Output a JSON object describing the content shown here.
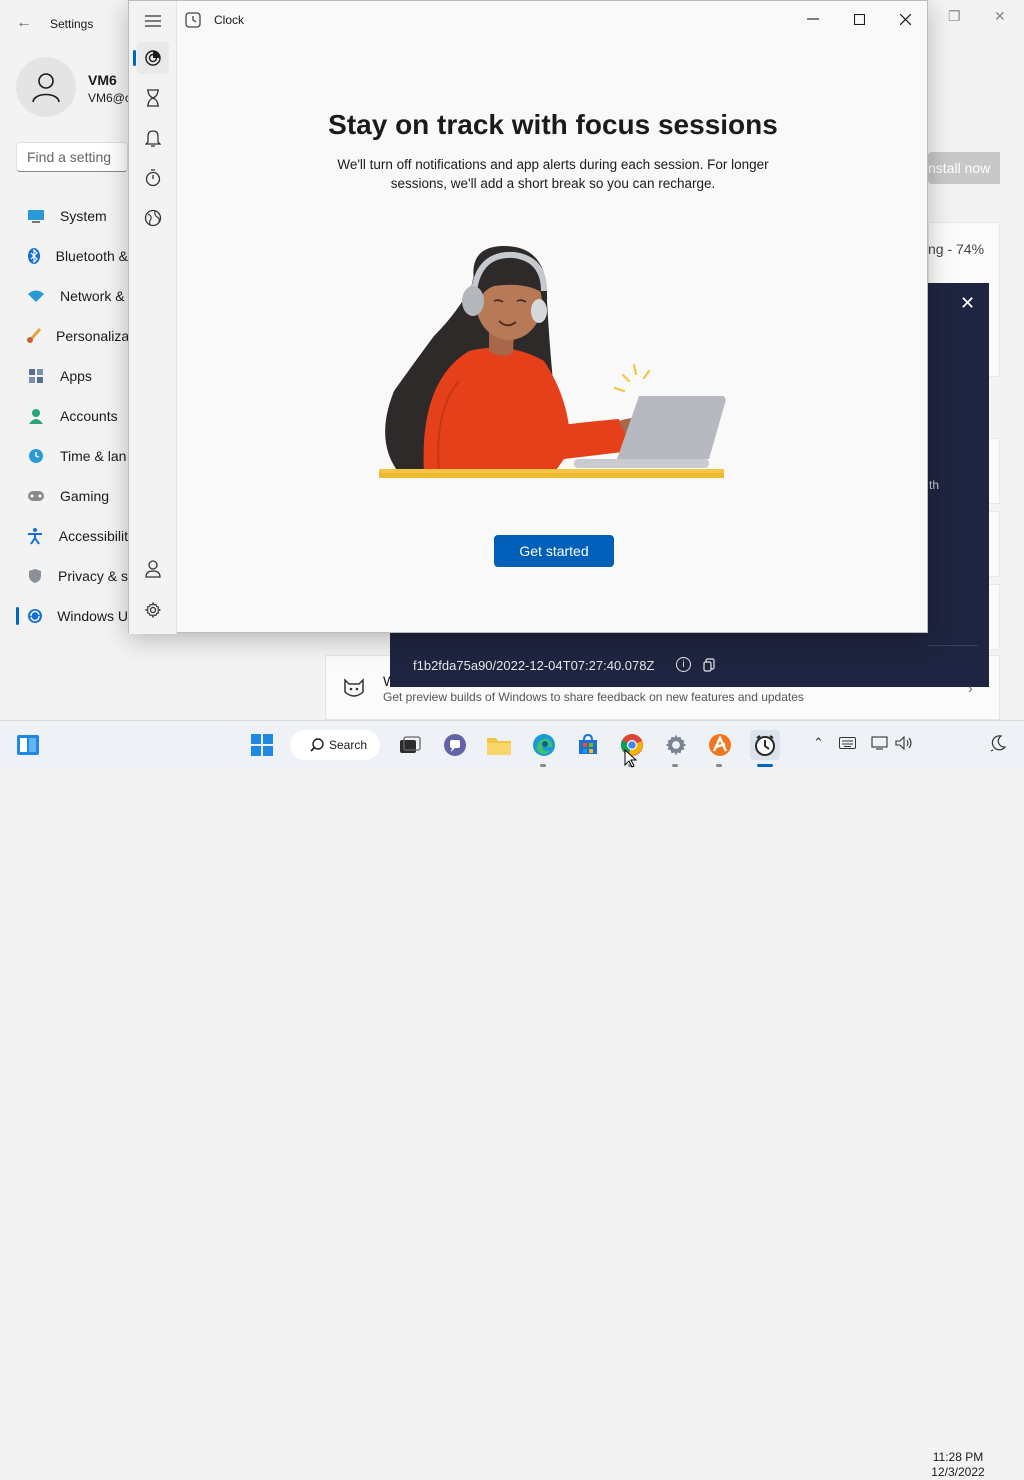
{
  "settings": {
    "title": "Settings",
    "user": {
      "name": "VM6",
      "email": "VM6@c"
    },
    "search_placeholder": "Find a setting",
    "nav": [
      {
        "label": "System",
        "icon": "monitor-icon"
      },
      {
        "label": "Bluetooth &",
        "icon": "bluetooth-icon"
      },
      {
        "label": "Network &",
        "icon": "wifi-icon"
      },
      {
        "label": "Personaliza",
        "icon": "brush-icon"
      },
      {
        "label": "Apps",
        "icon": "apps-icon"
      },
      {
        "label": "Accounts",
        "icon": "accounts-icon"
      },
      {
        "label": "Time & lan",
        "icon": "time-language-icon"
      },
      {
        "label": "Gaming",
        "icon": "controller-icon"
      },
      {
        "label": "Accessibilit",
        "icon": "accessibility-icon"
      },
      {
        "label": "Privacy & s",
        "icon": "shield-icon"
      },
      {
        "label": "Windows U",
        "icon": "windows-update-icon"
      }
    ],
    "install_button": "nstall now",
    "progress_text": "ng - 74%",
    "insider": {
      "title": "W",
      "description": "Get preview builds of Windows to share feedback on new features and updates"
    }
  },
  "dialog": {
    "partial_text": "th",
    "id": "f1b2fda75a90/2022-12-04T07:27:40.078Z"
  },
  "clock": {
    "title": "Clock",
    "heading": "Stay on track with focus sessions",
    "subtitle": "We'll turn off notifications and app alerts during each session. For longer sessions, we'll add a short break so you can recharge.",
    "cta": "Get started",
    "nav_icons": [
      "focus-sessions-icon",
      "timer-icon",
      "alarm-icon",
      "stopwatch-icon",
      "world-clock-icon"
    ],
    "bottom_icons": [
      "account-icon",
      "settings-icon"
    ]
  },
  "taskbar": {
    "search_label": "Search",
    "time": "11:28 PM",
    "date": "12/3/2022",
    "apps": [
      "start-icon",
      "search-icon",
      "task-view-icon",
      "teams-chat-icon",
      "file-explorer-icon",
      "edge-icon",
      "store-icon",
      "chrome-icon",
      "settings-app-icon",
      "avast-icon",
      "clock-app-icon"
    ]
  },
  "colors": {
    "accent": "#005fb8",
    "dialog_bg": "#1f2540",
    "sweater": "#e5401a",
    "desk": "#f4c542"
  }
}
